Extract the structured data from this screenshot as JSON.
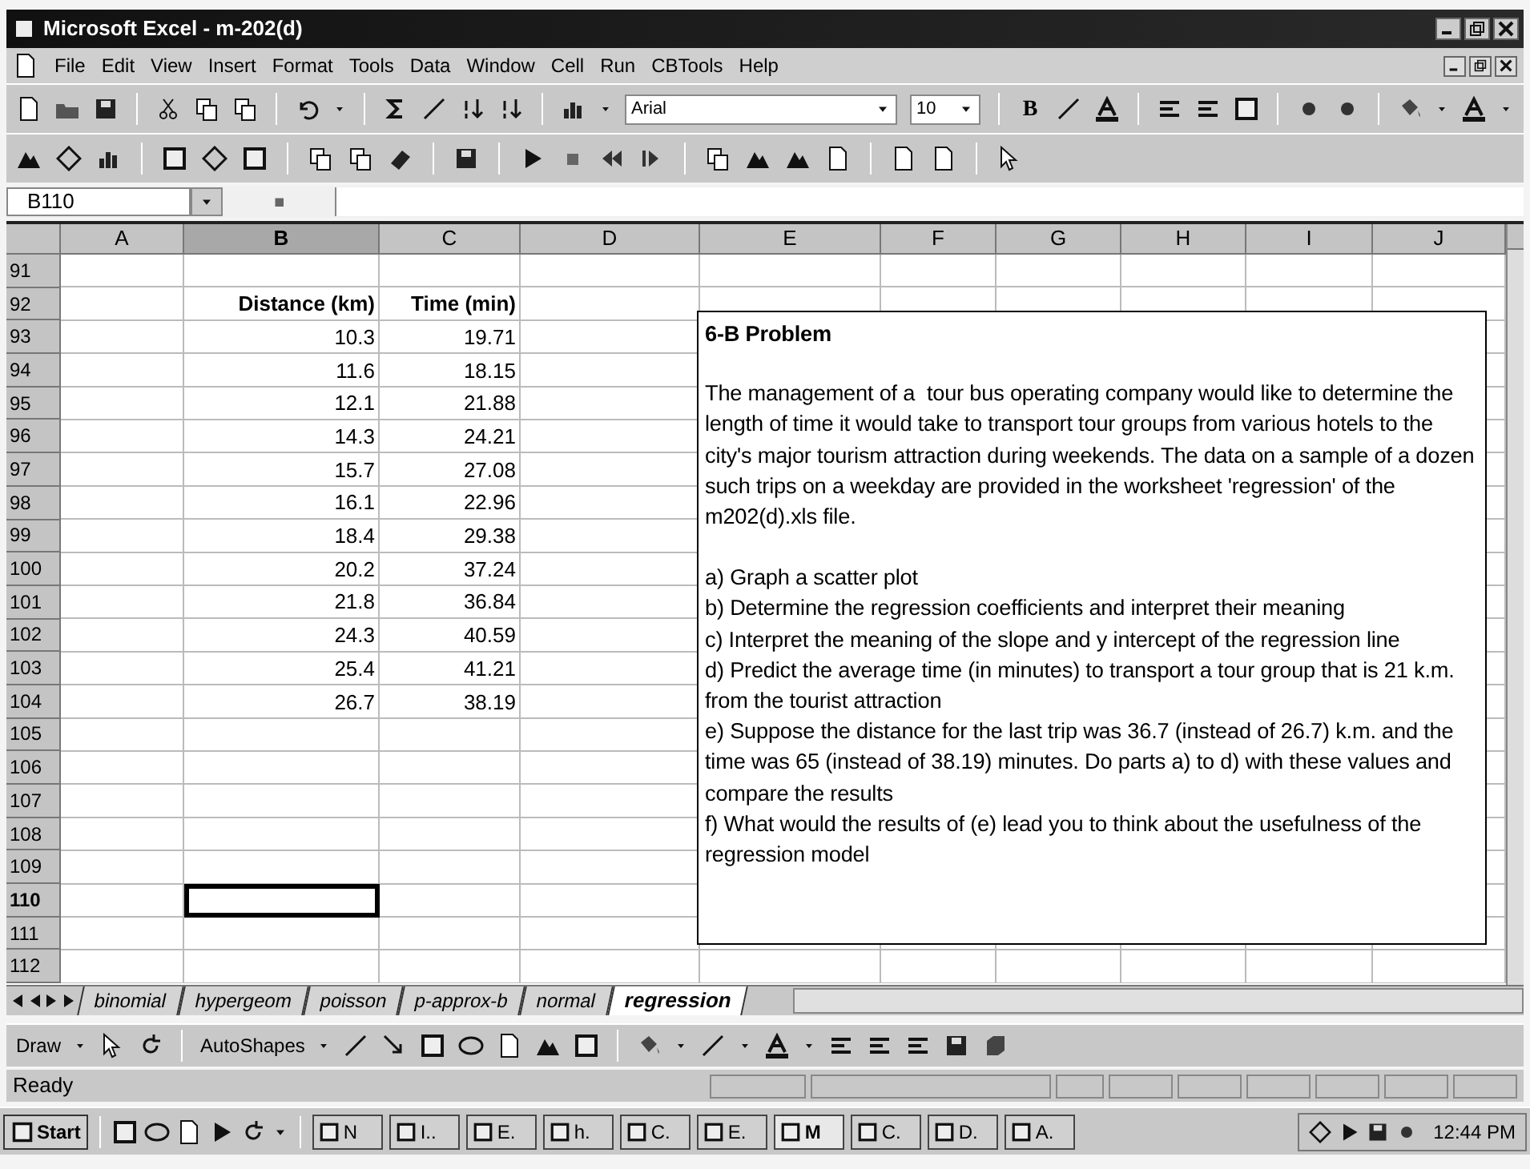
{
  "window": {
    "title": "Microsoft Excel - m-202(d)"
  },
  "menu": [
    "File",
    "Edit",
    "View",
    "Insert",
    "Format",
    "Tools",
    "Data",
    "Window",
    "Cell",
    "Run",
    "CBTools",
    "Help"
  ],
  "formatting": {
    "font": "Arial",
    "size": "10",
    "bold_button": "B"
  },
  "name_box": "B110",
  "columns": [
    {
      "label": "A",
      "selected": false
    },
    {
      "label": "B",
      "selected": true
    },
    {
      "label": "C",
      "selected": false
    },
    {
      "label": "D",
      "selected": false
    },
    {
      "label": "E",
      "selected": false
    },
    {
      "label": "F",
      "selected": false
    },
    {
      "label": "G",
      "selected": false
    },
    {
      "label": "H",
      "selected": false
    },
    {
      "label": "I",
      "selected": false
    },
    {
      "label": "J",
      "selected": false
    }
  ],
  "rows": [
    {
      "number": "91",
      "selected": false
    },
    {
      "number": "92",
      "selected": false,
      "kind": "header",
      "b": "Distance (km)",
      "c": "Time (min)"
    },
    {
      "number": "93",
      "selected": false,
      "kind": "data",
      "b": "10.3",
      "c": "19.71"
    },
    {
      "number": "94",
      "selected": false,
      "kind": "data",
      "b": "11.6",
      "c": "18.15"
    },
    {
      "number": "95",
      "selected": false,
      "kind": "data",
      "b": "12.1",
      "c": "21.88"
    },
    {
      "number": "96",
      "selected": false,
      "kind": "data",
      "b": "14.3",
      "c": "24.21"
    },
    {
      "number": "97",
      "selected": false,
      "kind": "data",
      "b": "15.7",
      "c": "27.08"
    },
    {
      "number": "98",
      "selected": false,
      "kind": "data",
      "b": "16.1",
      "c": "22.96"
    },
    {
      "number": "99",
      "selected": false,
      "kind": "data",
      "b": "18.4",
      "c": "29.38"
    },
    {
      "number": "100",
      "selected": false,
      "kind": "data",
      "b": "20.2",
      "c": "37.24"
    },
    {
      "number": "101",
      "selected": false,
      "kind": "data",
      "b": "21.8",
      "c": "36.84"
    },
    {
      "number": "102",
      "selected": false,
      "kind": "data",
      "b": "24.3",
      "c": "40.59"
    },
    {
      "number": "103",
      "selected": false,
      "kind": "data",
      "b": "25.4",
      "c": "41.21"
    },
    {
      "number": "104",
      "selected": false,
      "kind": "data",
      "b": "26.7",
      "c": "38.19"
    },
    {
      "number": "105",
      "selected": false
    },
    {
      "number": "106",
      "selected": false
    },
    {
      "number": "107",
      "selected": false
    },
    {
      "number": "108",
      "selected": false
    },
    {
      "number": "109",
      "selected": false
    },
    {
      "number": "110",
      "selected": true
    },
    {
      "number": "111",
      "selected": false
    },
    {
      "number": "112",
      "selected": false
    }
  ],
  "text_box": {
    "title": "6-B Problem",
    "intro": "The management of a  tour bus operating company would like to determine the length of time it would take to transport tour groups from various hotels to the city's major tourism attraction during weekends. The data on a sample of a dozen such trips on a weekday are provided in the worksheet 'regression' of the m202(d).xls file.",
    "items": [
      "a) Graph a scatter plot",
      "b) Determine the regression coefficients and interpret their meaning",
      "c) Interpret the meaning of the slope and y intercept of the regression line",
      "d) Predict the average time (in minutes) to transport a tour group that is 21 k.m. from the tourist attraction",
      "e) Suppose the distance for the last trip was 36.7 (instead of 26.7) k.m. and the time was 65 (instead of 38.19) minutes. Do parts a) to d) with these values and compare the results",
      "f) What would the results of (e) lead you to think about the usefulness of the regression model"
    ]
  },
  "sheet_tabs": [
    {
      "label": "binomial",
      "selected": false
    },
    {
      "label": "hypergeom",
      "selected": false
    },
    {
      "label": "poisson",
      "selected": false
    },
    {
      "label": "p-approx-b",
      "selected": false
    },
    {
      "label": "normal",
      "selected": false
    },
    {
      "label": "regression",
      "selected": true
    }
  ],
  "drawing_toolbar": {
    "draw": "Draw",
    "autoshapes": "AutoShapes"
  },
  "status_bar": "Ready",
  "taskbar": {
    "start": "Start",
    "tasks": [
      {
        "label": "N",
        "selected": false
      },
      {
        "label": "I..",
        "selected": false
      },
      {
        "label": "E.",
        "selected": false
      },
      {
        "label": "h.",
        "selected": false
      },
      {
        "label": "C.",
        "selected": false
      },
      {
        "label": "E.",
        "selected": false
      },
      {
        "label": "M",
        "selected": true
      },
      {
        "label": "C.",
        "selected": false
      },
      {
        "label": "D.",
        "selected": false
      },
      {
        "label": "A.",
        "selected": false
      }
    ],
    "clock": "12:44 PM"
  }
}
